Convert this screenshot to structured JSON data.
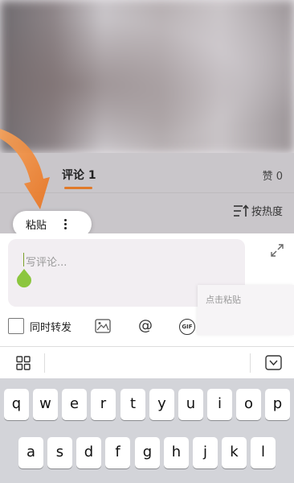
{
  "tabs": {
    "comments_label": "评论 1",
    "likes_label": "赞 0",
    "sort_label": "按热度"
  },
  "paste_popup": {
    "label": "粘贴"
  },
  "composer": {
    "placeholder": "写评论...",
    "paste_tip": "点击粘贴",
    "repost_label": "同时转发",
    "at_symbol": "@",
    "gif_label": "GIF"
  },
  "keyboard": {
    "row1": [
      "q",
      "w",
      "e",
      "r",
      "t",
      "y",
      "u",
      "i",
      "o",
      "p"
    ],
    "row2": [
      "a",
      "s",
      "d",
      "f",
      "g",
      "h",
      "j",
      "k",
      "l"
    ]
  },
  "colors": {
    "accent": "#e07a2a",
    "cursor": "#8cc63f"
  },
  "icons": [
    "arrow-pointer-icon",
    "sort-icon",
    "more-vert-icon",
    "expand-icon",
    "image-icon",
    "at-icon",
    "gif-icon",
    "grid-icon",
    "hide-keyboard-icon"
  ]
}
